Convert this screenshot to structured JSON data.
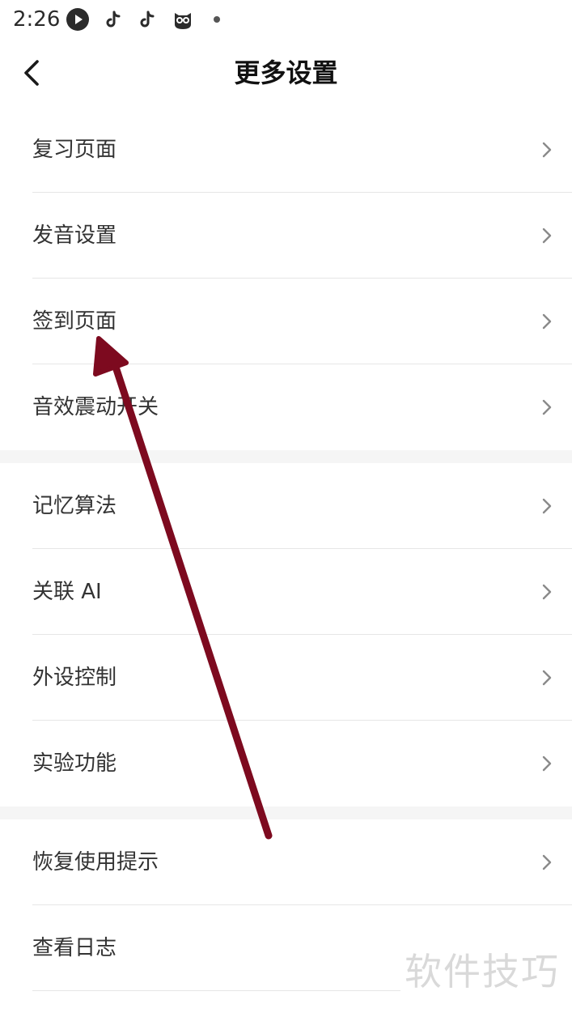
{
  "status_bar": {
    "time": "2:26",
    "icons": [
      "video-app-icon",
      "tiktok-icon",
      "tiktok-icon",
      "owl-app-icon",
      "dot-icon"
    ]
  },
  "header": {
    "title": "更多设置",
    "back_icon": "chevron-left-icon"
  },
  "settings": {
    "groups": [
      {
        "items": [
          {
            "label": "复习页面"
          },
          {
            "label": "发音设置"
          },
          {
            "label": "签到页面"
          },
          {
            "label": "音效震动开关"
          }
        ]
      },
      {
        "items": [
          {
            "label": "记忆算法"
          },
          {
            "label": "关联 AI"
          },
          {
            "label": "外设控制"
          },
          {
            "label": "实验功能"
          }
        ]
      },
      {
        "items": [
          {
            "label": "恢复使用提示"
          },
          {
            "label": "查看日志"
          }
        ]
      }
    ]
  },
  "annotation": {
    "color": "#7d0a1f",
    "icon": "arrow-annotation"
  },
  "watermark": {
    "text": "软件技巧"
  },
  "colors": {
    "text": "#333333",
    "title": "#111111",
    "chevron": "#8a8a8a",
    "divider": "#e6e6e6",
    "group_gap": "#f5f5f5"
  }
}
